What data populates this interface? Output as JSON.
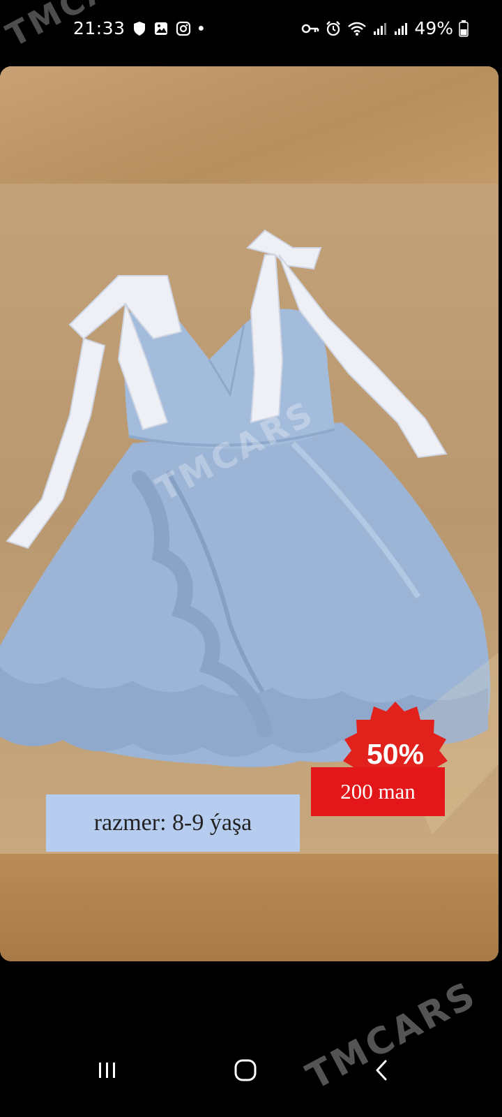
{
  "status_bar": {
    "time": "21:33",
    "battery": "49%",
    "left_icons": [
      "shield-icon",
      "gallery-icon",
      "instagram-icon",
      "dot-icon"
    ],
    "right_icons": [
      "key-icon",
      "alarm-icon",
      "wifi-icon",
      "signal-icon",
      "signal-icon",
      "battery-icon"
    ]
  },
  "listing": {
    "discount": "50%",
    "price": "200 man",
    "size": "razmer: 8-9 ýaşa",
    "watermark": "TMCARS"
  },
  "colors": {
    "dress": "#9db6d8",
    "bows": "#eef0f6",
    "discount_badge": "#e0211c",
    "price_box": "#e3171a",
    "size_box": "#b6cdf0"
  },
  "nav_bar": {
    "buttons": [
      "recent-apps",
      "home",
      "back"
    ]
  }
}
